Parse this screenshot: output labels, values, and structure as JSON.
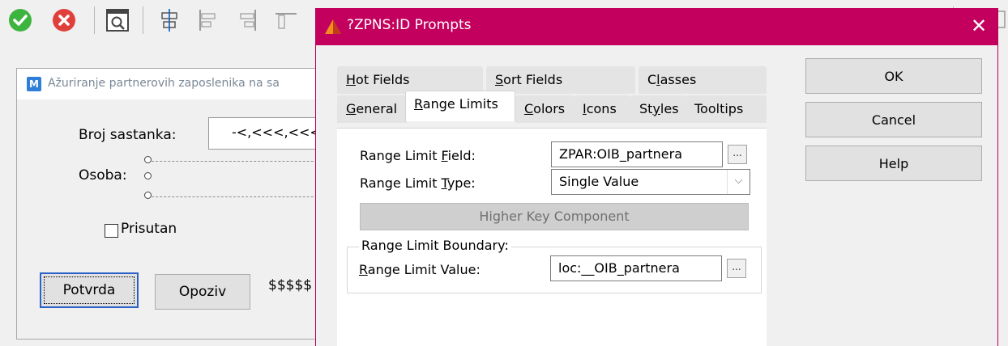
{
  "toolbar": {
    "buttons": [
      "check-icon",
      "cancel-icon",
      "preview-icon",
      "align-center-icon",
      "align-left-icon",
      "align-right-icon",
      "align-top-icon"
    ]
  },
  "background_window": {
    "title": "Ažuriranje partnerovih zaposlenika na sa",
    "logo": "M",
    "broj_label": "Broj sastanka:",
    "broj_value": "-<,<<<,<<<",
    "osoba_label": "Osoba:",
    "prisutan_label": "Prisutan",
    "prisutan_checked": false,
    "potvrda_label": "Potvrda",
    "opoziv_label": "Opoziv",
    "dollar_text": "$$$$$"
  },
  "dialog": {
    "title": "?ZPNS:ID Prompts",
    "close_glyph": "✕",
    "accent_color": "#c3005e",
    "tabs": {
      "hot_fields": {
        "pre": "",
        "u": "H",
        "post": "ot Fields"
      },
      "sort_fields": {
        "pre": "",
        "u": "S",
        "post": "ort Fields"
      },
      "classes": {
        "pre": "C",
        "u": "l",
        "post": "asses"
      },
      "general": {
        "pre": "",
        "u": "G",
        "post": "eneral"
      },
      "range_limits": {
        "pre": "",
        "u": "R",
        "post": "ange Limits"
      },
      "colors": {
        "pre": "",
        "u": "C",
        "post": "olors"
      },
      "icons": {
        "pre": "",
        "u": "I",
        "post": "cons"
      },
      "styles": {
        "pre": "St",
        "u": "y",
        "post": "les"
      },
      "tooltips": {
        "pre": "Tooltips",
        "u": "",
        "post": ""
      }
    },
    "active_tab": "Range Limits",
    "range_limit_field": {
      "label_pre": "Range Limit ",
      "label_u": "F",
      "label_post": "ield:",
      "value": "ZPAR:OIB_partnera",
      "button": "..."
    },
    "range_limit_type": {
      "label_pre": "Range Limit ",
      "label_u": "T",
      "label_post": "ype:",
      "value": "Single Value",
      "arrow": "⌵"
    },
    "higher_key_button": "Higher Key Component",
    "boundary": {
      "legend": "Range Limit Boundary:",
      "value_label_pre": "",
      "value_label_u": "R",
      "value_label_post": "ange Limit Value:",
      "value": "loc:__OIB_partnera",
      "button": "..."
    },
    "ok_label": "OK",
    "cancel_label": "Cancel",
    "help_label": "Help"
  }
}
